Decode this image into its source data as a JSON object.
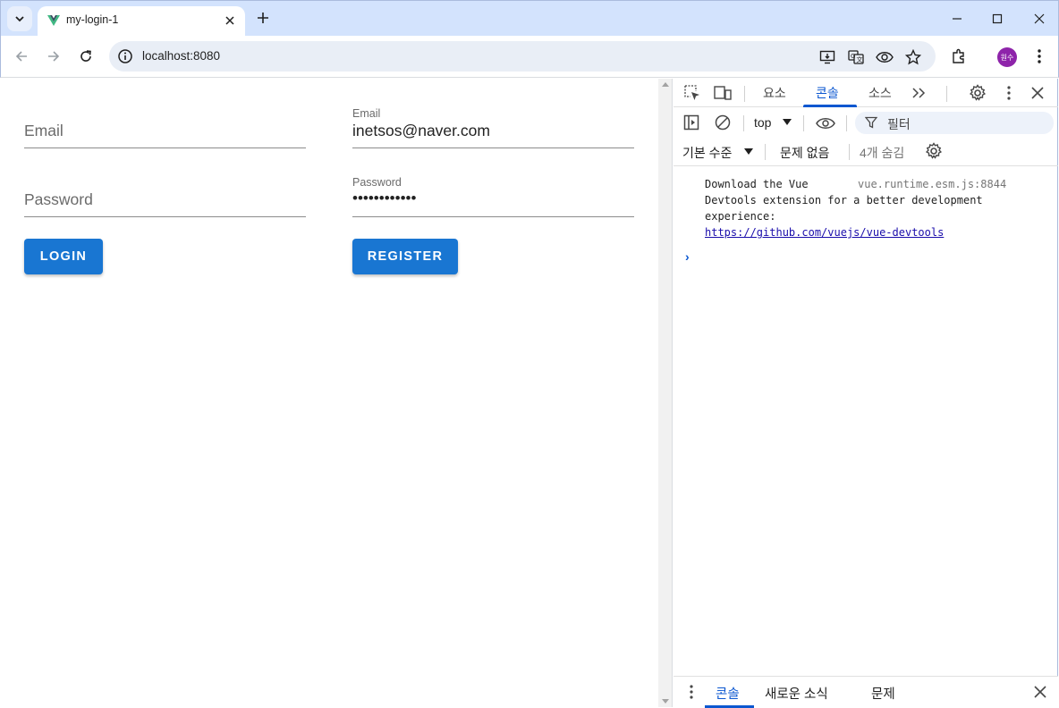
{
  "browser": {
    "tab_title": "my-login-1",
    "url": "localhost:8080",
    "profile_initials": "원수"
  },
  "login_form": {
    "email_placeholder": "Email",
    "password_placeholder": "Password",
    "button_label": "LOGIN"
  },
  "register_form": {
    "email_label": "Email",
    "email_value": "inetsos@naver.com",
    "password_label": "Password",
    "password_value": "••••••••••••",
    "button_label": "REGISTER"
  },
  "devtools": {
    "tabs": [
      "요소",
      "콘솔",
      "소스"
    ],
    "active_tab": "콘솔",
    "context": "top",
    "filter_placeholder": "필터",
    "level_label": "기본 수준",
    "issues_label": "문제 없음",
    "hidden_label": "4개 숨김",
    "message": {
      "line1": "Download the Vue",
      "line2": "Devtools extension for a better development",
      "line3": "experience:",
      "link": "https://github.com/vuejs/vue-devtools",
      "source": "vue.runtime.esm.js:8844"
    },
    "prompt": "›",
    "drawer_tabs": [
      "콘솔",
      "새로운 소식",
      "문제"
    ]
  },
  "colors": {
    "primary_button": "#1976d2",
    "devtools_accent": "#0b57d0",
    "tabbar": "#d3e3fd"
  }
}
